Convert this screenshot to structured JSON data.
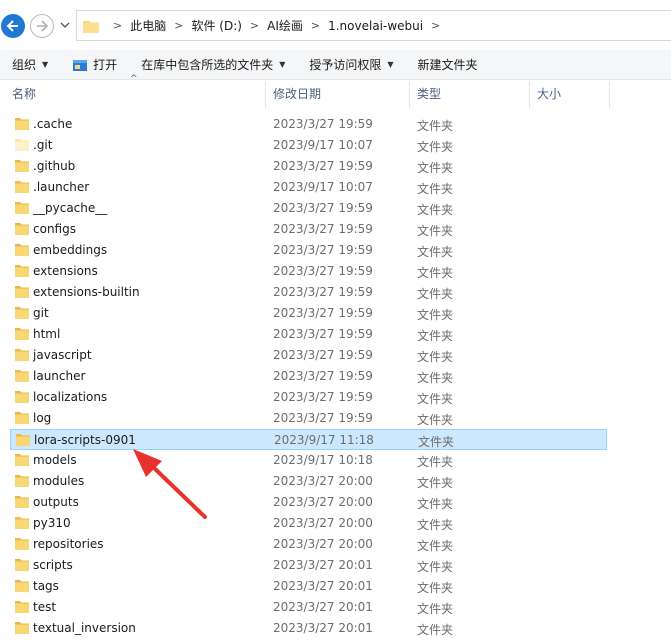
{
  "address": {
    "crumbs": [
      "此电脑",
      "软件 (D:)",
      "AI绘画",
      "1.novelai-webui"
    ]
  },
  "toolbar": {
    "organize": "组织",
    "open": "打开",
    "include_library": "在库中包含所选的文件夹",
    "grant_access": "授予访问权限",
    "new_folder": "新建文件夹"
  },
  "columns": {
    "name": "名称",
    "modified": "修改日期",
    "type": "类型",
    "size": "大小"
  },
  "files": [
    {
      "name": ".cache",
      "date": "2023/3/27 19:59",
      "type": "文件夹"
    },
    {
      "name": ".git",
      "date": "2023/9/17 10:07",
      "type": "文件夹"
    },
    {
      "name": ".github",
      "date": "2023/3/27 19:59",
      "type": "文件夹"
    },
    {
      "name": ".launcher",
      "date": "2023/9/17 10:07",
      "type": "文件夹"
    },
    {
      "name": "__pycache__",
      "date": "2023/3/27 19:59",
      "type": "文件夹"
    },
    {
      "name": "configs",
      "date": "2023/3/27 19:59",
      "type": "文件夹"
    },
    {
      "name": "embeddings",
      "date": "2023/3/27 19:59",
      "type": "文件夹"
    },
    {
      "name": "extensions",
      "date": "2023/3/27 19:59",
      "type": "文件夹"
    },
    {
      "name": "extensions-builtin",
      "date": "2023/3/27 19:59",
      "type": "文件夹"
    },
    {
      "name": "git",
      "date": "2023/3/27 19:59",
      "type": "文件夹"
    },
    {
      "name": "html",
      "date": "2023/3/27 19:59",
      "type": "文件夹"
    },
    {
      "name": "javascript",
      "date": "2023/3/27 19:59",
      "type": "文件夹"
    },
    {
      "name": "launcher",
      "date": "2023/3/27 19:59",
      "type": "文件夹"
    },
    {
      "name": "localizations",
      "date": "2023/3/27 19:59",
      "type": "文件夹"
    },
    {
      "name": "log",
      "date": "2023/3/27 19:59",
      "type": "文件夹"
    },
    {
      "name": "lora-scripts-0901",
      "date": "2023/9/17 11:18",
      "type": "文件夹",
      "selected": true
    },
    {
      "name": "models",
      "date": "2023/9/17 10:18",
      "type": "文件夹"
    },
    {
      "name": "modules",
      "date": "2023/3/27 20:00",
      "type": "文件夹"
    },
    {
      "name": "outputs",
      "date": "2023/3/27 20:00",
      "type": "文件夹"
    },
    {
      "name": "py310",
      "date": "2023/3/27 20:00",
      "type": "文件夹"
    },
    {
      "name": "repositories",
      "date": "2023/3/27 20:00",
      "type": "文件夹"
    },
    {
      "name": "scripts",
      "date": "2023/3/27 20:01",
      "type": "文件夹"
    },
    {
      "name": "tags",
      "date": "2023/3/27 20:01",
      "type": "文件夹"
    },
    {
      "name": "test",
      "date": "2023/3/27 20:01",
      "type": "文件夹"
    },
    {
      "name": "textual_inversion",
      "date": "2023/3/27 20:01",
      "type": "文件夹"
    }
  ],
  "colors": {
    "selection_bg": "#cce8ff",
    "selection_border": "#99d1ff",
    "folder": "#f8d775",
    "arrow": "#e8322b",
    "back_button": "#1f78d1"
  }
}
